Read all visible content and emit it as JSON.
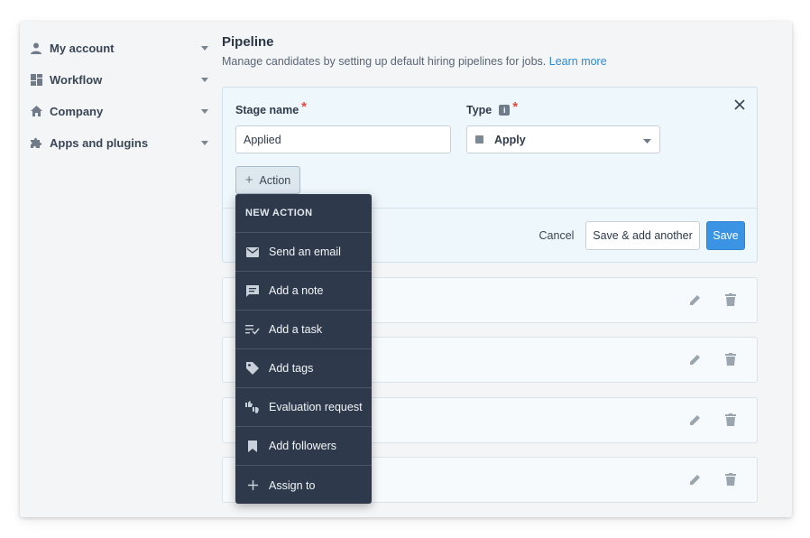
{
  "sidebar": {
    "items": [
      {
        "label": "My account",
        "icon": "person-icon"
      },
      {
        "label": "Workflow",
        "icon": "dashboard-icon"
      },
      {
        "label": "Company",
        "icon": "home-icon"
      },
      {
        "label": "Apps and plugins",
        "icon": "puzzle-icon"
      }
    ]
  },
  "header": {
    "title": "Pipeline",
    "subtitle": "Manage candidates by setting up default hiring pipelines for jobs.",
    "learn_more": "Learn more"
  },
  "editor": {
    "stage_name_label": "Stage name",
    "required_mark": "*",
    "stage_name_value": "Applied",
    "type_label": "Type",
    "info_mark": "i",
    "type_value": "Apply",
    "action_label": "Action",
    "cancel_label": "Cancel",
    "save_add_label": "Save & add another",
    "save_label": "Save"
  },
  "menu": {
    "header": "NEW ACTION",
    "items": [
      {
        "label": "Send an email",
        "icon": "mail-icon"
      },
      {
        "label": "Add a note",
        "icon": "comment-icon"
      },
      {
        "label": "Add a task",
        "icon": "task-list-icon"
      },
      {
        "label": "Add tags",
        "icon": "tag-icon"
      },
      {
        "label": "Evaluation request",
        "icon": "thumbs-icon"
      },
      {
        "label": "Add followers",
        "icon": "bookmark-icon"
      },
      {
        "label": "Assign to",
        "icon": "plus-icon"
      }
    ]
  },
  "colors": {
    "accent": "#3a94e3",
    "link": "#2a8bd8",
    "menu_bg": "#2e3a4b",
    "required": "#e5483d"
  }
}
